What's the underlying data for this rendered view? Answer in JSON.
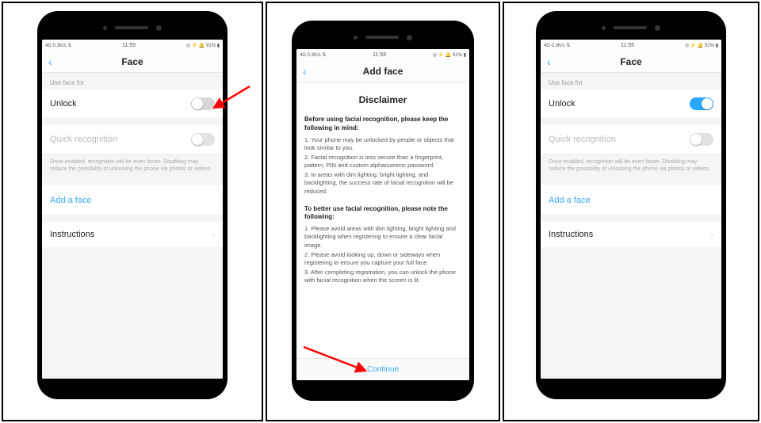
{
  "status": {
    "left": "4G  0.3K/s ⇅",
    "time": "11:55",
    "right": "◎ ⚡ 🔔 91% ▮"
  },
  "face": {
    "title": "Face",
    "section_label": "Use face for",
    "unlock_label": "Unlock",
    "quick_label": "Quick recognition",
    "quick_helper": "Once enabled, recognition will be even faster. Disabling may reduce the possibility of unlocking the phone via photos or videos.",
    "add_face": "Add a face",
    "instructions": "Instructions"
  },
  "disclaimer": {
    "header": "Add face",
    "title": "Disclaimer",
    "before_heading": "Before using facial recognition, please keep the following in mind:",
    "before_items": [
      "1. Your phone may be unlocked by people or objects that look similar to you.",
      "2. Facial recognition is less secure than a fingerprint, pattern, PIN and custom alphanumeric password.",
      "3. In areas with dim lighting, bright lighting, and backlighting, the success rate of facial recognition will be reduced."
    ],
    "better_heading": "To better use facial recognition, please note the following:",
    "better_items": [
      "1. Please avoid areas with dim lighting, bright lighting and backlighting when registering to ensure a clear facial image.",
      "2. Please avoid looking up, down or sideways when registering to ensure you capture your full face.",
      "3. After completing registration, you can unlock the phone with facial recognition when the screen is lit."
    ],
    "continue": "Continue"
  },
  "toggles": {
    "screen1_unlock": false,
    "screen1_quick": false,
    "screen3_unlock": true,
    "screen3_quick": false
  }
}
